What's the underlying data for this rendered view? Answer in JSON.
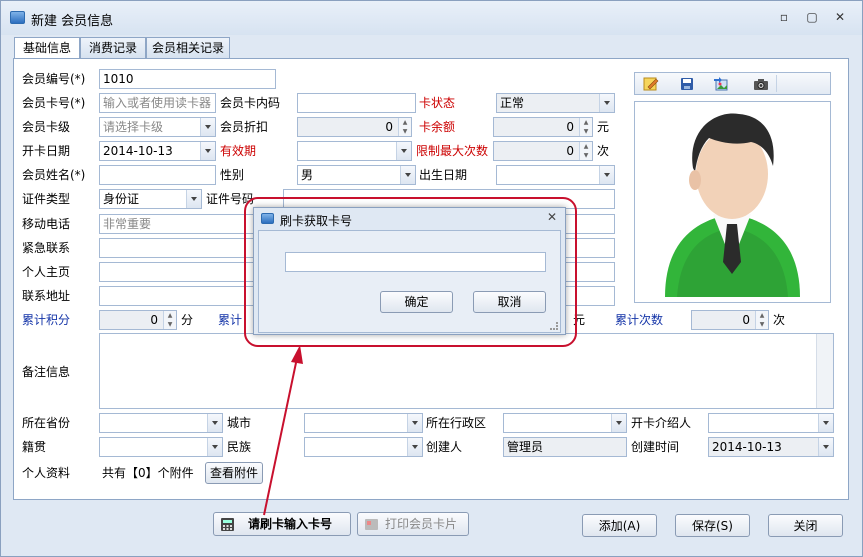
{
  "window": {
    "title": "新建 会员信息",
    "min": "▫",
    "max": "▢",
    "close": "✕"
  },
  "tabs": [
    "基础信息",
    "消费记录",
    "会员相关记录"
  ],
  "labels": {
    "member_no": "会员编号(*)",
    "card_no": "会员卡号(*)",
    "card_inner": "会员卡内码",
    "card_status": "卡状态",
    "card_level": "会员卡级",
    "discount": "会员折扣",
    "card_balance": "卡余额",
    "unit_yuan": "元",
    "open_date": "开卡日期",
    "valid": "有效期",
    "limit_times": "限制最大次数",
    "unit_times": "次",
    "name": "会员姓名(*)",
    "gender": "性别",
    "birthday": "出生日期",
    "id_type": "证件类型",
    "id_no": "证件号码",
    "mobile": "移动电话",
    "emergency": "紧急联系",
    "homepage": "个人主页",
    "address": "联系地址",
    "points": "累计积分",
    "points_unit": "分",
    "accum_money": "累计",
    "accum_unit": "元",
    "accum_times": "累计次数",
    "times_unit": "次",
    "remark": "备注信息",
    "province": "所在省份",
    "city": "城市",
    "district": "所在行政区",
    "referrer": "开卡介绍人",
    "native": "籍贯",
    "ethnic": "民族",
    "creator": "创建人",
    "created": "创建时间",
    "attachments": "个人资料",
    "attach_count": "共有【0】个附件"
  },
  "values": {
    "member_no": "1010",
    "card_no_ph": "输入或者使用读卡器",
    "card_status": "正常",
    "card_level_ph": "请选择卡级",
    "discount": "0",
    "balance": "0",
    "open_date": "2014-10-13",
    "limit_times": "0",
    "gender": "男",
    "id_type": "身份证",
    "mobile_ph": "非常重要",
    "points": "0",
    "accum_times": "0",
    "creator": "管理员",
    "created": "2014-10-13"
  },
  "buttons": {
    "view_attach": "查看附件",
    "swipe": "请刷卡输入卡号",
    "print": "打印会员卡片",
    "add": "添加(A)",
    "save": "保存(S)",
    "close": "关闭"
  },
  "dialog": {
    "title": "刷卡获取卡号",
    "ok": "确定",
    "cancel": "取消",
    "close": "✕"
  },
  "colors": {
    "red_label": "#cc0000",
    "blue_label": "#1535a8",
    "annotation": "#c8102e"
  }
}
